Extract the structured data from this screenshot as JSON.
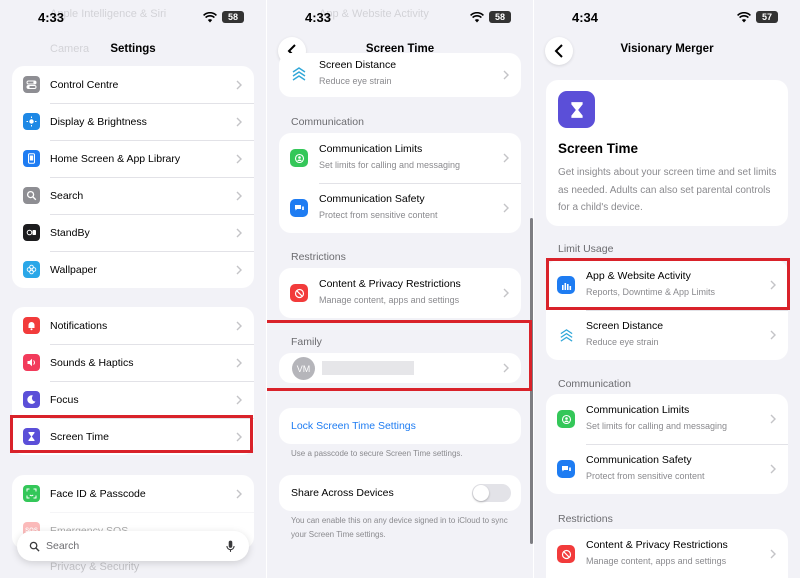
{
  "panel1": {
    "time": "4:33",
    "battery": "58",
    "title": "Settings",
    "faded_top": "Apple Intelligence & Siri",
    "faded_second": "Camera",
    "group1": [
      {
        "label": "Control Centre",
        "icon": "control-centre-icon",
        "color": "#8e8e93"
      },
      {
        "label": "Display & Brightness",
        "icon": "display-sun-icon",
        "color": "#1e88e5"
      },
      {
        "label": "Home Screen & App Library",
        "icon": "home-screen-icon",
        "color": "#1e7cf2"
      },
      {
        "label": "Search",
        "icon": "search-icon",
        "color": "#8e8e93"
      },
      {
        "label": "StandBy",
        "icon": "standby-icon",
        "color": "#1c1c1e"
      },
      {
        "label": "Wallpaper",
        "icon": "wallpaper-flower-icon",
        "color": "#2aa7e8"
      }
    ],
    "group2": [
      {
        "label": "Notifications",
        "icon": "bell-icon",
        "color": "#f23b3b"
      },
      {
        "label": "Sounds & Haptics",
        "icon": "speaker-icon",
        "color": "#f23b5b"
      },
      {
        "label": "Focus",
        "icon": "moon-icon",
        "color": "#5b4fd8"
      },
      {
        "label": "Screen Time",
        "icon": "hourglass-icon",
        "color": "#5b4fd8"
      }
    ],
    "group3": [
      {
        "label": "Face ID & Passcode",
        "icon": "face-id-icon",
        "color": "#34c759"
      },
      {
        "label": "Emergency SOS",
        "icon": "sos-icon",
        "color": "#f23b3b"
      }
    ],
    "faded_bottom": "Privacy & Security",
    "search_placeholder": "Search"
  },
  "panel2": {
    "time": "4:33",
    "battery": "58",
    "title": "Screen Time",
    "faded_top": "App & Website Activity",
    "screen_distance": {
      "title": "Screen Distance",
      "subtitle": "Reduce eye strain"
    },
    "communication_header": "Communication",
    "communication": [
      {
        "title": "Communication Limits",
        "subtitle": "Set limits for calling and messaging",
        "icon": "comm-limits-icon",
        "color": "#34c759"
      },
      {
        "title": "Communication Safety",
        "subtitle": "Protect from sensitive content",
        "icon": "comm-safety-icon",
        "color": "#1e7cf2"
      }
    ],
    "restrictions_header": "Restrictions",
    "restrictions": [
      {
        "title": "Content & Privacy Restrictions",
        "subtitle": "Manage content, apps and settings",
        "icon": "restriction-icon",
        "color": "#f23b3b"
      }
    ],
    "family_header": "Family",
    "family_initials": "VM",
    "lock_label": "Lock Screen Time Settings",
    "lock_note": "Use a passcode to secure Screen Time settings.",
    "share_label": "Share Across Devices",
    "share_on": false,
    "share_note": "You can enable this on any device signed in to iCloud to sync your Screen Time settings."
  },
  "panel3": {
    "time": "4:34",
    "battery": "57",
    "title": "Visionary Merger",
    "hero_title": "Screen Time",
    "hero_desc": "Get insights about your screen time and set limits as needed. Adults can also set parental controls for a child's device.",
    "limit_header": "Limit Usage",
    "limit": [
      {
        "title": "App & Website Activity",
        "subtitle": "Reports, Downtime & App Limits",
        "icon": "activity-chart-icon",
        "color": "#1e7cf2"
      },
      {
        "title": "Screen Distance",
        "subtitle": "Reduce eye strain",
        "icon": "distance-icon",
        "color": "#ffffff"
      }
    ],
    "communication_header": "Communication",
    "communication": [
      {
        "title": "Communication Limits",
        "subtitle": "Set limits for calling and messaging",
        "icon": "comm-limits-icon",
        "color": "#34c759"
      },
      {
        "title": "Communication Safety",
        "subtitle": "Protect from sensitive content",
        "icon": "comm-safety-icon",
        "color": "#1e7cf2"
      }
    ],
    "restrictions_header": "Restrictions",
    "restrictions": [
      {
        "title": "Content & Privacy Restrictions",
        "subtitle": "Manage content, apps and settings",
        "icon": "restriction-icon",
        "color": "#f23b3b"
      }
    ]
  },
  "colors": {
    "highlight": "#d9222a",
    "link": "#1e7cf2",
    "accent": "#5b4fd8"
  }
}
